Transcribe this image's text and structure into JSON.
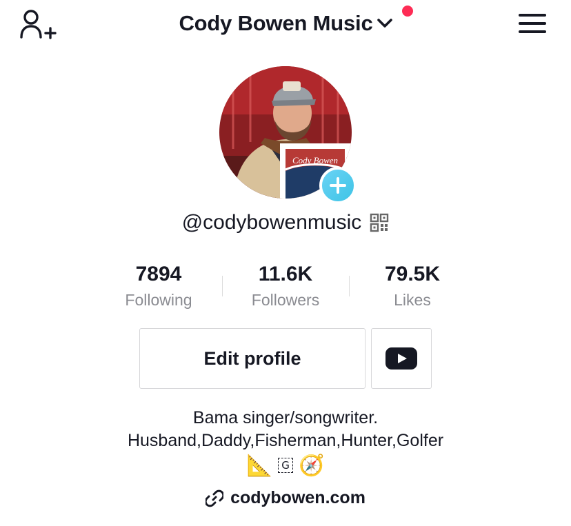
{
  "header": {
    "title": "Cody Bowen Music",
    "notification_color": "#fe2c55"
  },
  "profile": {
    "handle": "@codybowenmusic",
    "avatar_badge_text": "Cody Bowen"
  },
  "stats": [
    {
      "value": "7894",
      "label": "Following"
    },
    {
      "value": "11.6K",
      "label": "Followers"
    },
    {
      "value": "79.5K",
      "label": "Likes"
    }
  ],
  "actions": {
    "edit_profile_label": "Edit profile"
  },
  "bio": {
    "line1": "Bama singer/songwriter.",
    "line2": "Husband,Daddy,Fisherman,Hunter,Golfer",
    "emoji_ruler": "📐",
    "glyph_box": "G",
    "emoji_compass": "🧭"
  },
  "link": {
    "text": "codybowen.com"
  },
  "icons": [
    "add-user-icon",
    "chevron-down-icon",
    "menu-icon",
    "plus-icon",
    "qr-code-icon",
    "youtube-icon",
    "link-icon"
  ]
}
